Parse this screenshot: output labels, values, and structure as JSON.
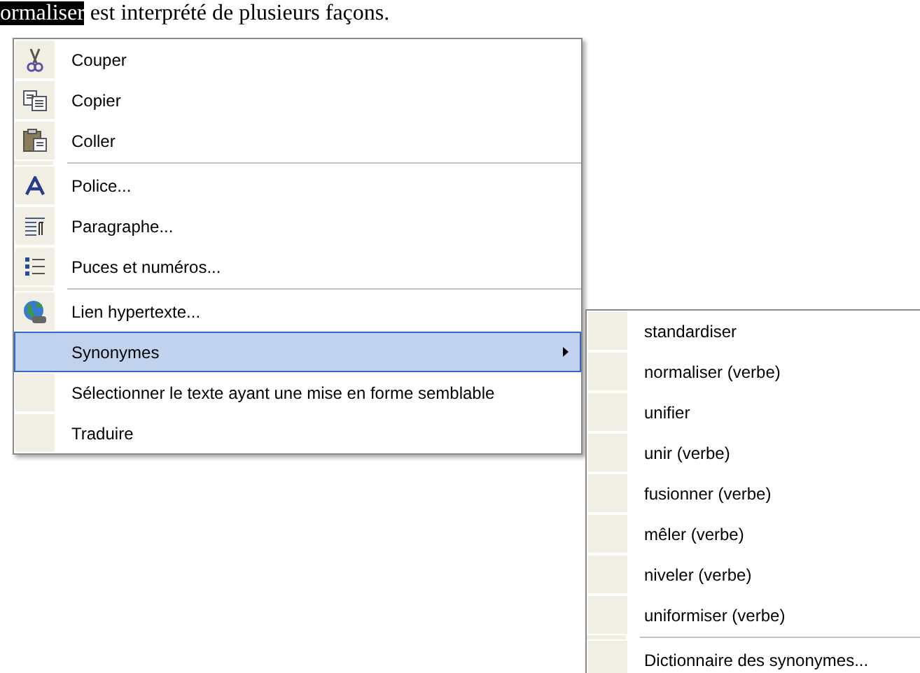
{
  "document": {
    "selected_word": "ormaliser",
    "text": " est interprété de plusieurs façons."
  },
  "context_menu": {
    "items": [
      {
        "kind": "command",
        "label": "Couper",
        "selected": false
      },
      {
        "kind": "command",
        "label": "Copier",
        "selected": false
      },
      {
        "kind": "command",
        "label": "Coller",
        "selected": false
      },
      {
        "kind": "separator"
      },
      {
        "kind": "command",
        "label": "Police...",
        "selected": false
      },
      {
        "kind": "command",
        "label": "Paragraphe...",
        "selected": false
      },
      {
        "kind": "command",
        "label": "Puces et numéros...",
        "selected": false
      },
      {
        "kind": "separator"
      },
      {
        "kind": "command",
        "label": "Lien hypertexte...",
        "selected": false
      },
      {
        "kind": "submenu",
        "label": "Synonymes",
        "selected": true
      },
      {
        "kind": "command",
        "label": "Sélectionner le texte ayant une mise en forme semblable",
        "selected": false
      },
      {
        "kind": "command",
        "label": "Traduire",
        "selected": false
      }
    ]
  },
  "submenu": {
    "items": [
      {
        "kind": "command",
        "label": "standardiser",
        "selected": false
      },
      {
        "kind": "command",
        "label": "normaliser (verbe)",
        "selected": false
      },
      {
        "kind": "command",
        "label": "unifier",
        "selected": false
      },
      {
        "kind": "command",
        "label": "unir (verbe)",
        "selected": false
      },
      {
        "kind": "command",
        "label": "fusionner (verbe)",
        "selected": false
      },
      {
        "kind": "command",
        "label": "mêler (verbe)",
        "selected": false
      },
      {
        "kind": "command",
        "label": "niveler (verbe)",
        "selected": false
      },
      {
        "kind": "command",
        "label": "uniformiser (verbe)",
        "selected": false
      },
      {
        "kind": "separator"
      },
      {
        "kind": "command",
        "label": "Dictionnaire des synonymes...",
        "selected": false
      }
    ]
  }
}
